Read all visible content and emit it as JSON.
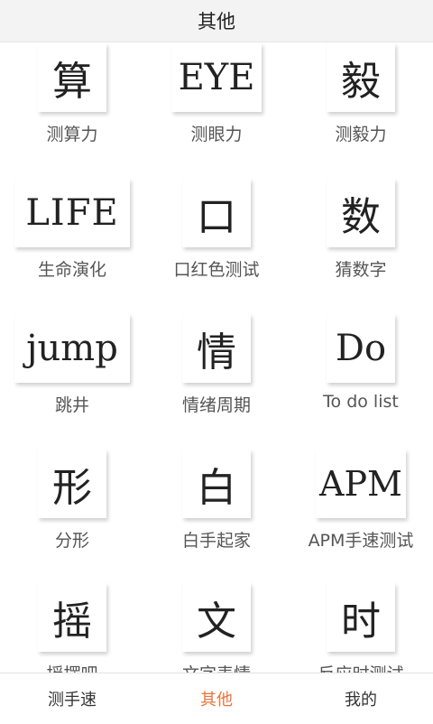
{
  "header": {
    "title": "其他"
  },
  "tiles": [
    {
      "glyph": "算",
      "label": "测算力"
    },
    {
      "glyph": "EYE",
      "label": "测眼力"
    },
    {
      "glyph": "毅",
      "label": "测毅力"
    },
    {
      "glyph": "LIFE",
      "label": "生命演化"
    },
    {
      "glyph": "口",
      "label": "口红色测试"
    },
    {
      "glyph": "数",
      "label": "猜数字"
    },
    {
      "glyph": "jump",
      "label": "跳井"
    },
    {
      "glyph": "情",
      "label": "情绪周期"
    },
    {
      "glyph": "Do",
      "label": "To do list"
    },
    {
      "glyph": "形",
      "label": "分形"
    },
    {
      "glyph": "白",
      "label": "白手起家"
    },
    {
      "glyph": "APM",
      "label": "APM手速测试"
    },
    {
      "glyph": "摇",
      "label": "摇摆吧"
    },
    {
      "glyph": "文",
      "label": "文字表情"
    },
    {
      "glyph": "时",
      "label": "反应时测试"
    }
  ],
  "bottom_nav": [
    {
      "label": "测手速"
    },
    {
      "label": "其他"
    },
    {
      "label": "我的"
    }
  ],
  "colors": {
    "active_tab": "#e8743b",
    "topbar_bg": "#f3f3f3"
  }
}
